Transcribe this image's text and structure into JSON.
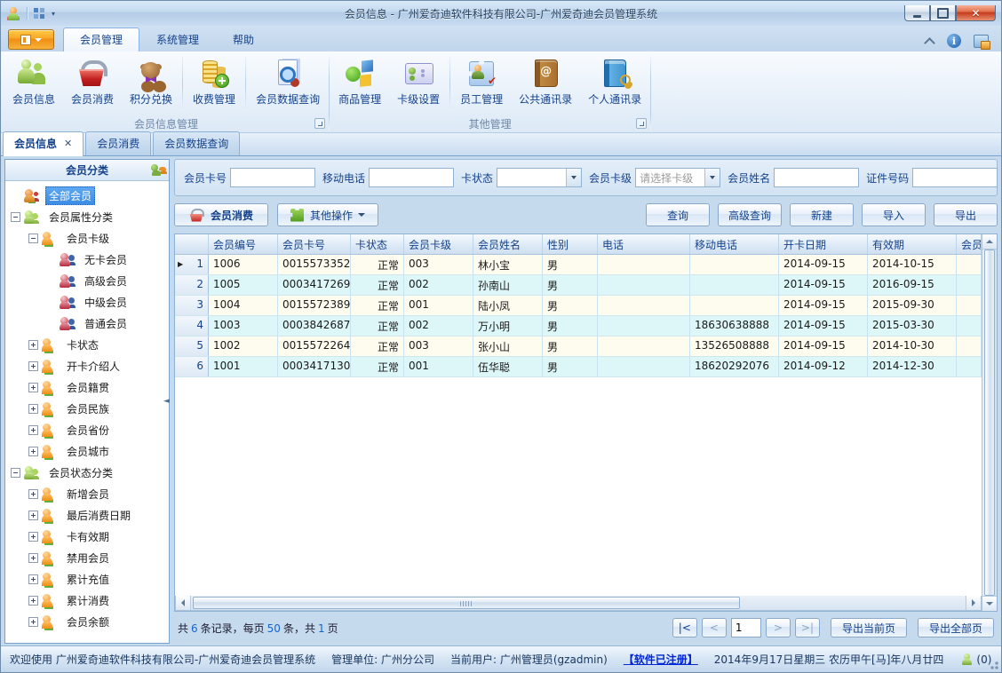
{
  "window": {
    "title": "会员信息 - 广州爱奇迪软件科技有限公司-广州爱奇迪会员管理系统"
  },
  "ribbon": {
    "tabs": [
      {
        "label": "会员管理",
        "state": "active"
      },
      {
        "label": "系统管理"
      },
      {
        "label": "帮助"
      }
    ],
    "group1": {
      "label": "会员信息管理",
      "buttons": [
        {
          "label": "会员信息",
          "icon": "ic-members"
        },
        {
          "label": "会员消费",
          "icon": "ic-basket"
        },
        {
          "label": "积分兑换",
          "icon": "ic-bear"
        },
        {
          "label": "收费管理",
          "icon": "ic-coins",
          "sep_before": true
        },
        {
          "label": "会员数据查询",
          "icon": "ic-docsearch",
          "sep_before": true
        }
      ]
    },
    "group2": {
      "label": "其他管理",
      "buttons": [
        {
          "label": "商品管理",
          "icon": "ic-goods"
        },
        {
          "label": "卡级设置",
          "icon": "ic-card"
        },
        {
          "label": "员工管理",
          "icon": "ic-staff",
          "sep_before": true
        },
        {
          "label": "公共通讯录",
          "icon": "ic-pubbook"
        },
        {
          "label": "个人通讯录",
          "icon": "ic-persbook"
        }
      ]
    }
  },
  "doc_tabs": [
    {
      "label": "会员信息",
      "state": "active",
      "closable": true
    },
    {
      "label": "会员消费"
    },
    {
      "label": "会员数据查询"
    }
  ],
  "sidebar": {
    "title": "会员分类",
    "tree": [
      {
        "label": "全部会员",
        "depth": 1,
        "icon": "crowd",
        "expander": "none",
        "sel": "selected"
      },
      {
        "label": "会员属性分类",
        "depth": 1,
        "icon": "grp-green",
        "expander": "minus"
      },
      {
        "label": "会员卡级",
        "depth": 2,
        "icon": "grp-orange",
        "expander": "minus"
      },
      {
        "label": "无卡会员",
        "depth": 3,
        "icon": "duo",
        "expander": "none"
      },
      {
        "label": "高级会员",
        "depth": 3,
        "icon": "duo",
        "expander": "none"
      },
      {
        "label": "中级会员",
        "depth": 3,
        "icon": "duo",
        "expander": "none"
      },
      {
        "label": "普通会员",
        "depth": 3,
        "icon": "duo",
        "expander": "none"
      },
      {
        "label": "卡状态",
        "depth": 2,
        "icon": "grp-orange",
        "expander": "plus"
      },
      {
        "label": "开卡介绍人",
        "depth": 2,
        "icon": "grp-orange",
        "expander": "plus"
      },
      {
        "label": "会员籍贯",
        "depth": 2,
        "icon": "grp-orange",
        "expander": "plus"
      },
      {
        "label": "会员民族",
        "depth": 2,
        "icon": "grp-orange",
        "expander": "plus"
      },
      {
        "label": "会员省份",
        "depth": 2,
        "icon": "grp-orange",
        "expander": "plus"
      },
      {
        "label": "会员城市",
        "depth": 2,
        "icon": "grp-orange",
        "expander": "plus"
      },
      {
        "label": "会员状态分类",
        "depth": 1,
        "icon": "grp-green",
        "expander": "minus"
      },
      {
        "label": "新增会员",
        "depth": 2,
        "icon": "grp-orange",
        "expander": "plus"
      },
      {
        "label": "最后消费日期",
        "depth": 2,
        "icon": "grp-orange",
        "expander": "plus"
      },
      {
        "label": "卡有效期",
        "depth": 2,
        "icon": "grp-orange",
        "expander": "plus"
      },
      {
        "label": "禁用会员",
        "depth": 2,
        "icon": "grp-orange",
        "expander": "plus"
      },
      {
        "label": "累计充值",
        "depth": 2,
        "icon": "grp-orange",
        "expander": "plus"
      },
      {
        "label": "累计消费",
        "depth": 2,
        "icon": "grp-orange",
        "expander": "plus"
      },
      {
        "label": "会员余额",
        "depth": 2,
        "icon": "grp-orange",
        "expander": "plus"
      }
    ]
  },
  "filters": [
    {
      "label": "会员卡号",
      "is_input": true,
      "value": ""
    },
    {
      "label": "移动电话",
      "is_input": true,
      "value": ""
    },
    {
      "label": "卡状态",
      "is_select": true,
      "value": ""
    },
    {
      "label": "会员卡级",
      "is_select": true,
      "value": "请选择卡级",
      "value_class": "muted"
    },
    {
      "label": "会员姓名",
      "is_input": true,
      "value": ""
    },
    {
      "label": "证件号码",
      "is_input": true,
      "value": ""
    }
  ],
  "actions": {
    "consume_label": "会员消费",
    "other_label": "其他操作",
    "right_buttons": [
      {
        "label": "查询"
      },
      {
        "label": "高级查询"
      },
      {
        "label": "新建"
      },
      {
        "label": "导入"
      },
      {
        "label": "导出"
      }
    ]
  },
  "table": {
    "headers": [
      {
        "t": "会员编号",
        "c": "c1"
      },
      {
        "t": "会员卡号",
        "c": "c2"
      },
      {
        "t": "卡状态",
        "c": "c3"
      },
      {
        "t": "会员卡级",
        "c": "c4"
      },
      {
        "t": "会员姓名",
        "c": "c5"
      },
      {
        "t": "性别",
        "c": "c6"
      },
      {
        "t": "电话",
        "c": "c7"
      },
      {
        "t": "移动电话",
        "c": "c8"
      },
      {
        "t": "开卡日期",
        "c": "c9"
      },
      {
        "t": "有效期",
        "c": "c10"
      },
      {
        "t": "会员",
        "c": "c11"
      }
    ],
    "rows": [
      {
        "n": "1",
        "id": "1006",
        "card": "0015573352",
        "st": "正常",
        "lv": "003",
        "nm": "林小宝",
        "sx": "男",
        "ph": "",
        "mb": "",
        "od": "2014-09-15",
        "vd": "2014-10-15",
        "ex": ""
      },
      {
        "n": "2",
        "id": "1005",
        "card": "0003417269",
        "st": "正常",
        "lv": "002",
        "nm": "孙南山",
        "sx": "男",
        "ph": "",
        "mb": "",
        "od": "2014-09-15",
        "vd": "2016-09-15",
        "ex": ""
      },
      {
        "n": "3",
        "id": "1004",
        "card": "0015572389",
        "st": "正常",
        "lv": "001",
        "nm": "陆小凤",
        "sx": "男",
        "ph": "",
        "mb": "",
        "od": "2014-09-15",
        "vd": "2015-09-30",
        "ex": ""
      },
      {
        "n": "4",
        "id": "1003",
        "card": "0003842687",
        "st": "正常",
        "lv": "002",
        "nm": "万小明",
        "sx": "男",
        "ph": "",
        "mb": "18630638888",
        "od": "2014-09-15",
        "vd": "2015-03-30",
        "ex": ""
      },
      {
        "n": "5",
        "id": "1002",
        "card": "0015572264",
        "st": "正常",
        "lv": "003",
        "nm": "张小山",
        "sx": "男",
        "ph": "",
        "mb": "13526508888",
        "od": "2014-09-15",
        "vd": "2014-10-30",
        "ex": ""
      },
      {
        "n": "6",
        "id": "1001",
        "card": "0003417130",
        "st": "正常",
        "lv": "001",
        "nm": "伍华聪",
        "sx": "男",
        "ph": "",
        "mb": "18620292076",
        "od": "2014-09-12",
        "vd": "2014-12-30",
        "ex": ""
      }
    ]
  },
  "pagination": {
    "summary": {
      "p1": "共",
      "n1": "6",
      "p2": "条记录，每页",
      "n2": "50",
      "p3": "条，共",
      "n3": "1",
      "p4": "页"
    },
    "first": "|<",
    "prev": "<",
    "page": "1",
    "next": ">",
    "last": ">|",
    "export_current": "导出当前页",
    "export_all": "导出全部页"
  },
  "statusbar": {
    "welcome": "欢迎使用 广州爱奇迪软件科技有限公司-广州爱奇迪会员管理系统",
    "unit": "管理单位: 广州分公司",
    "user": "当前用户: 广州管理员(gzadmin)",
    "registered": "【软件已注册】",
    "date": "2014年9月17日星期三 农历甲午[马]年八月廿四",
    "online_count": "(0)"
  }
}
